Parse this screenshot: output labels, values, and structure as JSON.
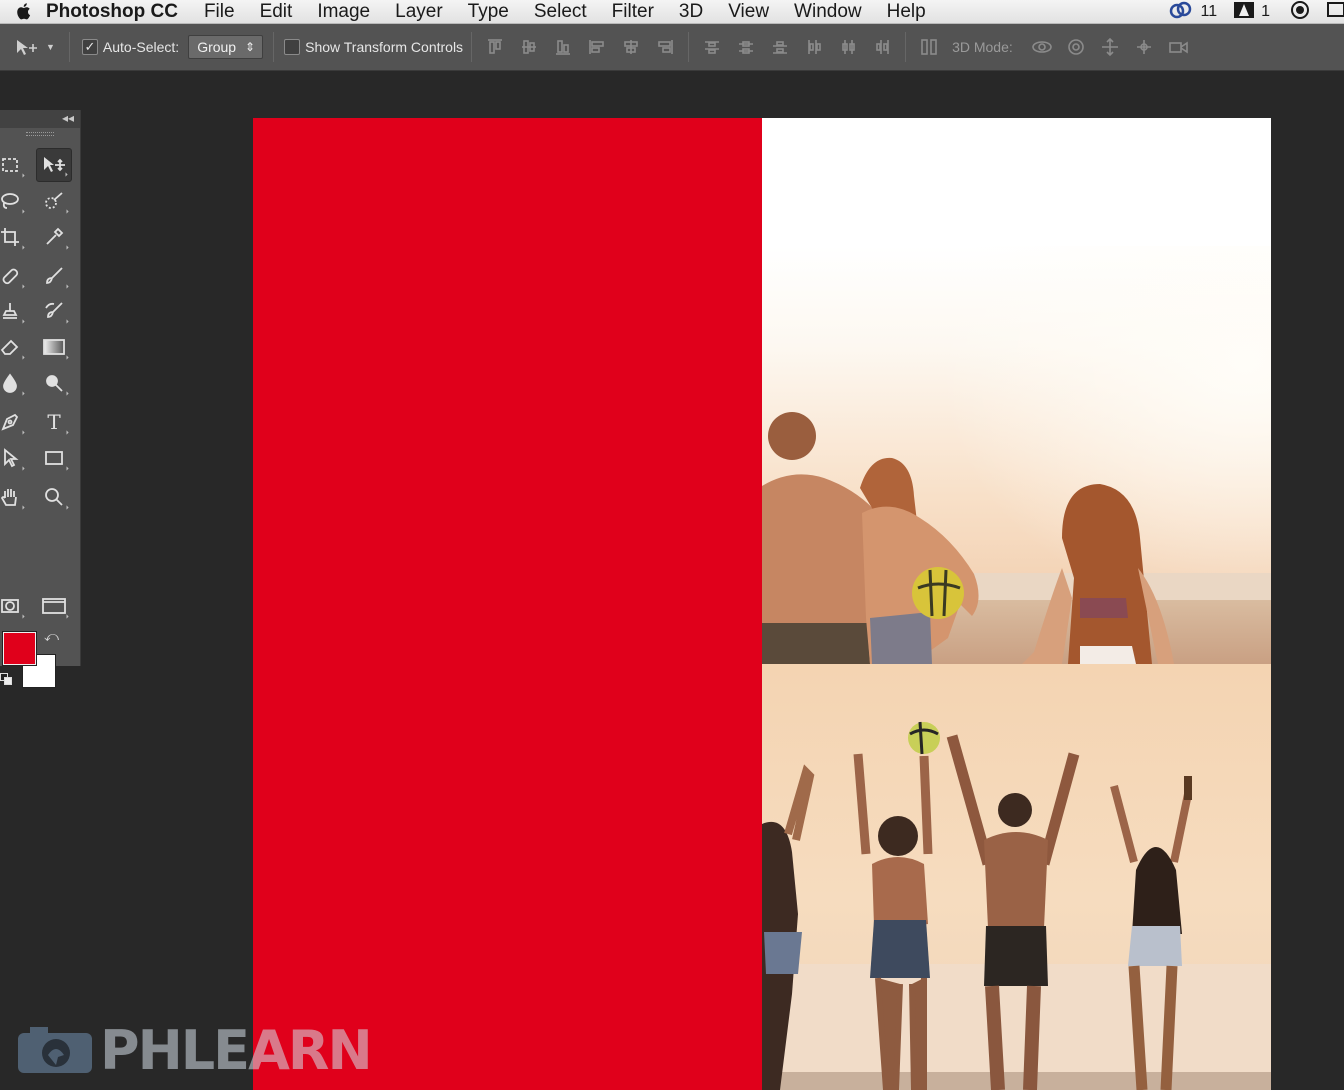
{
  "menubar": {
    "app_name": "Photoshop CC",
    "menus": [
      "File",
      "Edit",
      "Image",
      "Layer",
      "Type",
      "Select",
      "Filter",
      "3D",
      "View",
      "Window",
      "Help"
    ],
    "status_count_1": "11",
    "status_count_2": "1"
  },
  "options": {
    "auto_select_label": "Auto-Select:",
    "auto_select_checked": true,
    "auto_select_value": "Group",
    "show_transform_label": "Show Transform Controls",
    "show_transform_checked": false,
    "mode_label": "3D Mode:"
  },
  "tools": {
    "foreground_color": "#e0001b",
    "background_color": "#ffffff",
    "type_tool_glyph": "T"
  },
  "icons": {
    "move": "move-tool-icon",
    "marquee": "rect-marquee-icon",
    "lasso": "lasso-icon",
    "quick_select": "quick-select-icon",
    "crop": "crop-icon",
    "eyedropper": "eyedropper-icon",
    "healing": "healing-brush-icon",
    "brush": "brush-icon",
    "stamp": "clone-stamp-icon",
    "history_brush": "history-brush-icon",
    "eraser": "eraser-icon",
    "gradient": "gradient-icon",
    "blur": "blur-icon",
    "dodge": "dodge-icon",
    "pen": "pen-icon",
    "type": "type-icon",
    "path_select": "path-selection-icon",
    "rectangle": "rectangle-icon",
    "hand": "hand-icon",
    "zoom": "zoom-icon",
    "quick_mask": "quick-mask-icon",
    "screen_mode": "screen-mode-icon"
  },
  "canvas": {
    "left_block_color": "#e0001b"
  },
  "watermark": {
    "text": "PHLEARN"
  }
}
